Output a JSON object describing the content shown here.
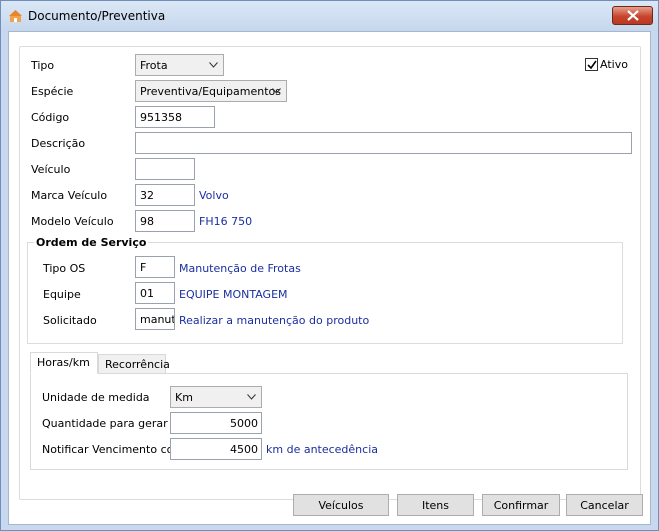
{
  "window": {
    "title": "Documento/Preventiva"
  },
  "form": {
    "tipo_label": "Tipo",
    "tipo_value": "Frota",
    "ativo_label": "Ativo",
    "ativo_checked": true,
    "especie_label": "Espécie",
    "especie_value": "Preventiva/Equipamentos",
    "codigo_label": "Código",
    "codigo_value": "951358",
    "descricao_label": "Descrição",
    "descricao_value": "",
    "veiculo_label": "Veículo",
    "veiculo_value": "",
    "marca_label": "Marca Veículo",
    "marca_code": "32",
    "marca_name": "Volvo",
    "modelo_label": "Modelo Veículo",
    "modelo_code": "98",
    "modelo_name": "FH16 750"
  },
  "ordem_servico": {
    "title": "Ordem de Serviço",
    "tipo_os_label": "Tipo OS",
    "tipo_os_code": "F",
    "tipo_os_name": "Manutenção de Frotas",
    "equipe_label": "Equipe",
    "equipe_code": "01",
    "equipe_name": "EQUIPE MONTAGEM",
    "solicitado_label": "Solicitado",
    "solicitado_code": "manut",
    "solicitado_text": "Realizar a manutenção do produto"
  },
  "tabs": [
    {
      "label": "Horas/km",
      "active": true
    },
    {
      "label": "Recorrência",
      "active": false
    }
  ],
  "horas_km": {
    "unidade_label": "Unidade de medida",
    "unidade_value": "Km",
    "quantidade_label": "Quantidade para gerar",
    "quantidade_value": "5000",
    "notificar_label": "Notificar Vencimento com",
    "notificar_value": "4500",
    "notificar_suffix": "km de antecedência"
  },
  "buttons": {
    "veiculos": "Veículos",
    "itens": "Itens",
    "confirmar": "Confirmar",
    "cancelar": "Cancelar"
  },
  "colors": {
    "accent_text": "#1a2ea0",
    "title_bar": "#c6d7ed",
    "close_button": "#c7452c",
    "app_icon": "#e8852a"
  },
  "icons": {
    "app": "app-icon",
    "close": "close-icon",
    "dropdown": "chevron-down-icon",
    "check": "check-icon"
  }
}
